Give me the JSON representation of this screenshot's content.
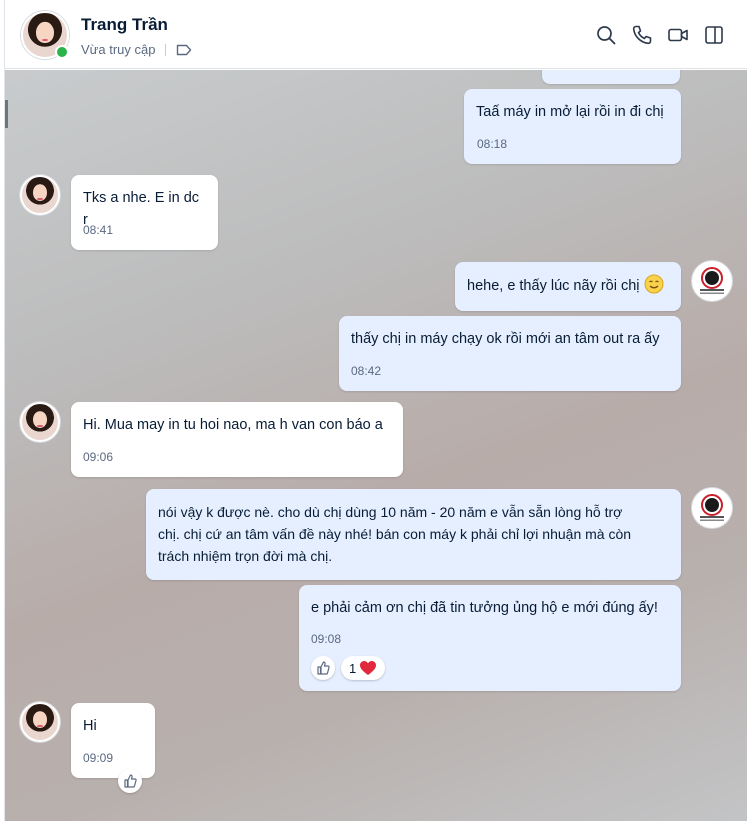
{
  "header": {
    "contact_name": "Trang Trần",
    "status": "Vừa truy cập",
    "icons": [
      "search-icon",
      "phone-icon",
      "video-call-icon",
      "sidebar-toggle-icon"
    ]
  },
  "messages": [
    {
      "id": "m1",
      "side": "out",
      "text": "Taấ máy in mở lại rồi in đi chị",
      "time": "08:18"
    },
    {
      "id": "m2",
      "side": "in",
      "text": "Tks a nhe. E in dc r",
      "time": "08:41"
    },
    {
      "id": "m3",
      "side": "out",
      "text": "hehe, e thấy lúc nãy rồi chị",
      "emoji": "smile-emoji"
    },
    {
      "id": "m4",
      "side": "out",
      "text": "thấy chị in máy chạy ok rồi mới an tâm out ra ấy",
      "time": "08:42"
    },
    {
      "id": "m5",
      "side": "in",
      "text": "Hi. Mua may in tu hoi nao, ma h van con báo a",
      "time": "09:06"
    },
    {
      "id": "m6",
      "side": "out",
      "lines": [
        "nói vậy k được nè. cho dù chị dùng 10 năm - 20 năm e vẫn sẵn lòng hỗ trợ",
        "chị. chị cứ an tâm vấn đề này nhé! bán con máy k phải chỉ lợi nhuận mà còn",
        "trách nhiệm trọn đời mà chị."
      ]
    },
    {
      "id": "m7",
      "side": "out",
      "text": "e phải cảm ơn chị đã tin tưởng ủng hộ e mới đúng ấy!",
      "time": "09:08",
      "reaction_count": "1"
    },
    {
      "id": "m8",
      "side": "in",
      "text": "Hi",
      "time": "09:09"
    }
  ],
  "colors": {
    "bubble_out": "#e5efff",
    "bubble_in": "#ffffff",
    "online": "#2ab34a",
    "heart": "#e0293d"
  }
}
